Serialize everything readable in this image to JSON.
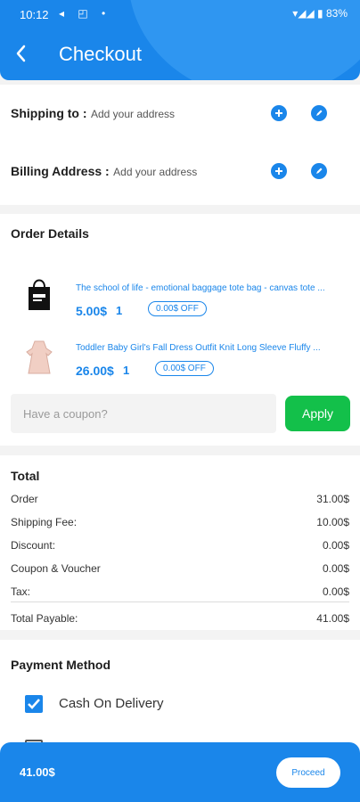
{
  "status_bar": {
    "time": "10:12",
    "notif_icons": "◂ ◰ •",
    "battery": "83%"
  },
  "header": {
    "title": "Checkout"
  },
  "shipping": {
    "label": "Shipping to :",
    "placeholder": "Add your address"
  },
  "billing": {
    "label": "Billing Address :",
    "placeholder": "Add your address"
  },
  "order_details": {
    "title": "Order Details",
    "items": [
      {
        "name": "The school of life - emotional baggage tote bag - canvas tote ...",
        "price": "5.00$",
        "qty": "1",
        "discount": "0.00$ OFF"
      },
      {
        "name": "Toddler Baby Girl's Fall Dress Outfit Knit Long Sleeve Fluffy ...",
        "price": "26.00$",
        "qty": "1",
        "discount": "0.00$ OFF"
      }
    ],
    "coupon_placeholder": "Have a coupon?",
    "apply_label": "Apply"
  },
  "total": {
    "title": "Total",
    "rows": [
      {
        "label": "Order",
        "value": "31.00$"
      },
      {
        "label": "Shipping Fee:",
        "value": "10.00$"
      },
      {
        "label": "Discount:",
        "value": "0.00$"
      },
      {
        "label": "Coupon & Voucher",
        "value": "0.00$"
      },
      {
        "label": "Tax:",
        "value": "0.00$"
      }
    ],
    "payable_label": "Total Payable:",
    "payable_value": "41.00$"
  },
  "payment": {
    "title": "Payment Method",
    "option_cod": "Cash On Delivery"
  },
  "bottom_bar": {
    "total": "41.00$",
    "proceed_label": "Proceed"
  },
  "colors": {
    "primary": "#1a86ea",
    "apply_green": "#13c04a"
  }
}
